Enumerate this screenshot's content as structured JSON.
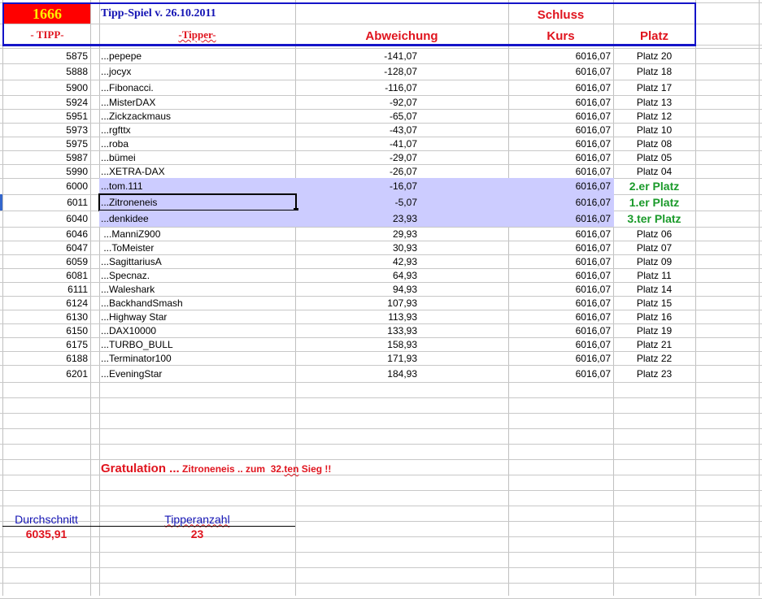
{
  "header": {
    "number": "1666",
    "title": "Tipp-Spiel v. 26.10.2011",
    "schluss": "Schluss",
    "col_tipp": "- TIPP-",
    "col_tipper": "-Tipper-",
    "col_abweichung": "Abweichung",
    "col_kurs": "Kurs",
    "col_platz": "Platz"
  },
  "colors": {
    "red": "#e0141e",
    "blue": "#1414b4",
    "highlight": "#ccccff",
    "green": "#1a9a2a"
  },
  "rows": [
    {
      "tipp": "5875",
      "name": "...pepepe",
      "abw": "-141,07",
      "kurs": "6016,07",
      "platz": "Platz 20"
    },
    {
      "tipp": "5888",
      "name": "...jocyx",
      "abw": "-128,07",
      "kurs": "6016,07",
      "platz": "Platz 18"
    },
    {
      "tipp": "5900",
      "name": "...Fibonacci.",
      "abw": "-116,07",
      "kurs": "6016,07",
      "platz": "Platz 17"
    },
    {
      "tipp": "5924",
      "name": "...MisterDAX",
      "abw": "-92,07",
      "kurs": "6016,07",
      "platz": "Platz 13"
    },
    {
      "tipp": "5951",
      "name": "...Zickzackmaus",
      "abw": "-65,07",
      "kurs": "6016,07",
      "platz": "Platz 12"
    },
    {
      "tipp": "5973",
      "name": "...rgfttx",
      "abw": "-43,07",
      "kurs": "6016,07",
      "platz": "Platz 10"
    },
    {
      "tipp": "5975",
      "name": "...roba",
      "abw": "-41,07",
      "kurs": "6016,07",
      "platz": "Platz 08"
    },
    {
      "tipp": "5987",
      "name": "...bümei",
      "abw": "-29,07",
      "kurs": "6016,07",
      "platz": "Platz 05"
    },
    {
      "tipp": "5990",
      "name": "...XETRA-DAX",
      "abw": "-26,07",
      "kurs": "6016,07",
      "platz": "Platz 04"
    },
    {
      "tipp": "6000",
      "name": "...tom.111",
      "abw": "-16,07",
      "kurs": "6016,07",
      "platz": "2.er Platz",
      "highlight": true
    },
    {
      "tipp": "6011",
      "name": "...Zitroneneis",
      "abw": "-5,07",
      "kurs": "6016,07",
      "platz": "1.er Platz",
      "highlight": true,
      "selected": true
    },
    {
      "tipp": "6040",
      "name": "...denkidee",
      "abw": "23,93",
      "kurs": "6016,07",
      "platz": "3.ter Platz",
      "highlight": true
    },
    {
      "tipp": "6046",
      "name": " ...ManniZ900",
      "abw": "29,93",
      "kurs": "6016,07",
      "platz": "Platz 06"
    },
    {
      "tipp": "6047",
      "name": " ...ToMeister",
      "abw": "30,93",
      "kurs": "6016,07",
      "platz": "Platz 07"
    },
    {
      "tipp": "6059",
      "name": "...SagittariusA",
      "abw": "42,93",
      "kurs": "6016,07",
      "platz": "Platz 09"
    },
    {
      "tipp": "6081",
      "name": "...Specnaz.",
      "abw": "64,93",
      "kurs": "6016,07",
      "platz": "Platz 11"
    },
    {
      "tipp": "6111",
      "name": "...Waleshark",
      "abw": "94,93",
      "kurs": "6016,07",
      "platz": "Platz 14"
    },
    {
      "tipp": "6124",
      "name": "...BackhandSmash",
      "abw": "107,93",
      "kurs": "6016,07",
      "platz": "Platz 15"
    },
    {
      "tipp": "6130",
      "name": "...Highway Star",
      "abw": "113,93",
      "kurs": "6016,07",
      "platz": "Platz 16"
    },
    {
      "tipp": "6150",
      "name": "...DAX10000",
      "abw": "133,93",
      "kurs": "6016,07",
      "platz": "Platz 19"
    },
    {
      "tipp": "6175",
      "name": "...TURBO_BULL",
      "abw": "158,93",
      "kurs": "6016,07",
      "platz": "Platz 21"
    },
    {
      "tipp": "6188",
      "name": "...Terminator100",
      "abw": "171,93",
      "kurs": "6016,07",
      "platz": "Platz 22"
    },
    {
      "tipp": "6201",
      "name": "...EveningStar",
      "abw": "184,93",
      "kurs": "6016,07",
      "platz": "Platz 23"
    }
  ],
  "footer": {
    "gratulation": "Gratulation ...",
    "message_pre": "Zitroneneis .. zum  32.",
    "message_ten": "ten",
    "message_post": " Sieg !!",
    "avg_label": "Durchschnitt",
    "avg_value": "6035,91",
    "count_label": "Tipperanzahl",
    "count_value": "23"
  }
}
